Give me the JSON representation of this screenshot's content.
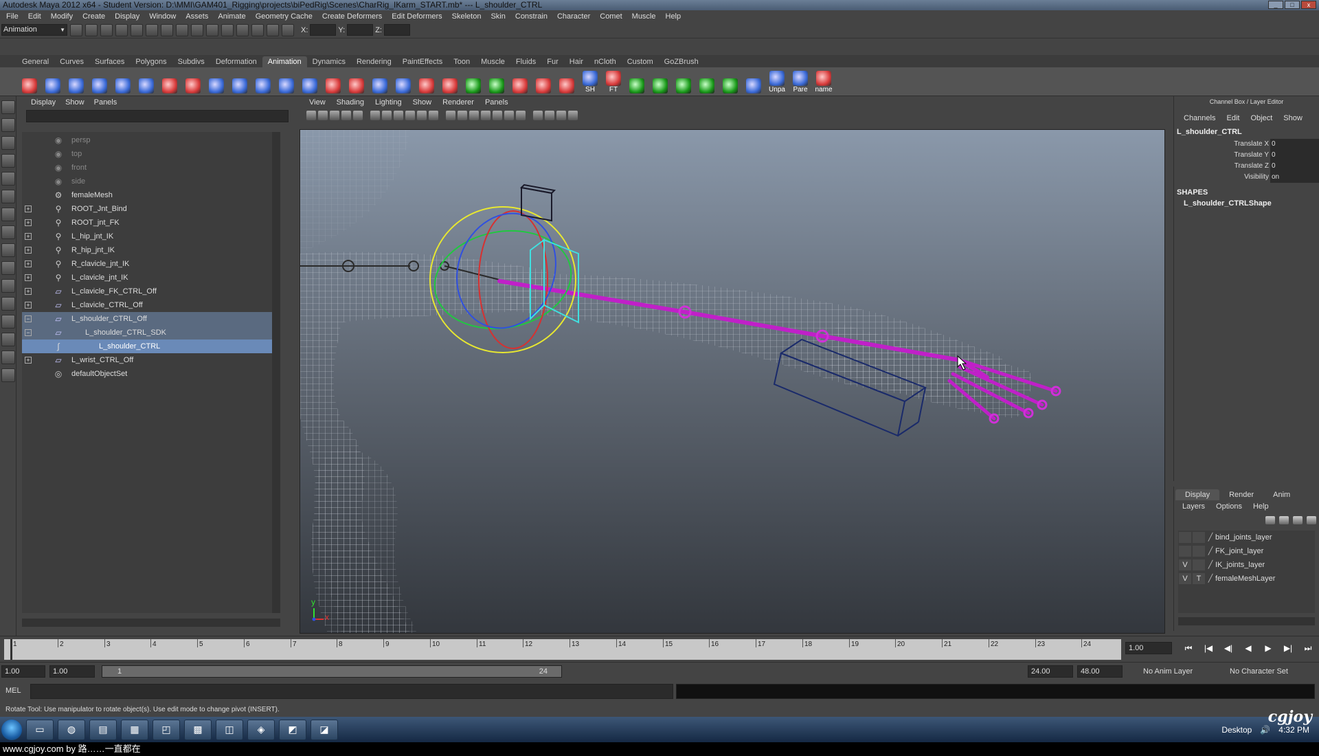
{
  "window": {
    "title": "Autodesk Maya 2012 x64 - Student Version: D:\\MMI\\GAM401_Rigging\\projects\\biPedRig\\Scenes\\CharRig_IKarm_START.mb*  ---  L_shoulder_CTRL"
  },
  "menubar": [
    "File",
    "Edit",
    "Modify",
    "Create",
    "Display",
    "Window",
    "Assets",
    "Animate",
    "Geometry Cache",
    "Create Deformers",
    "Edit Deformers",
    "Skeleton",
    "Skin",
    "Constrain",
    "Character",
    "Comet",
    "Muscle",
    "Help"
  ],
  "statusline": {
    "mode": "Animation",
    "x_label": "X:",
    "y_label": "Y:",
    "z_label": "Z:"
  },
  "shelf_tabs": [
    "General",
    "Curves",
    "Surfaces",
    "Polygons",
    "Subdivs",
    "Deformation",
    "Animation",
    "Dynamics",
    "Rendering",
    "PaintEffects",
    "Toon",
    "Muscle",
    "Fluids",
    "Fur",
    "Hair",
    "nCloth",
    "Custom",
    "GoZBrush"
  ],
  "shelf_active": "Animation",
  "shelf_labels": {
    "sh": "SH",
    "ft": "FT",
    "unpa": "Unpa",
    "pare": "Pare",
    "name": "name"
  },
  "outliner": {
    "menu": [
      "Display",
      "Show",
      "Panels"
    ],
    "rows": [
      {
        "label": "persp",
        "type": "camera"
      },
      {
        "label": "top",
        "type": "camera"
      },
      {
        "label": "front",
        "type": "camera"
      },
      {
        "label": "side",
        "type": "camera"
      },
      {
        "label": "femaleMesh",
        "type": "mesh"
      },
      {
        "label": "ROOT_Jnt_Bind",
        "type": "joint"
      },
      {
        "label": "ROOT_jnt_FK",
        "type": "joint"
      },
      {
        "label": "L_hip_jnt_IK",
        "type": "joint"
      },
      {
        "label": "R_hip_jnt_IK",
        "type": "joint"
      },
      {
        "label": "R_clavicle_jnt_IK",
        "type": "joint"
      },
      {
        "label": "L_clavicle_jnt_IK",
        "type": "joint"
      },
      {
        "label": "L_clavicle_FK_CTRL_Off",
        "type": "transform"
      },
      {
        "label": "L_clavicle_CTRL_Off",
        "type": "transform"
      },
      {
        "label": "L_shoulder_CTRL_Off",
        "type": "transform"
      },
      {
        "label": "L_shoulder_CTRL_SDK",
        "type": "transform"
      },
      {
        "label": "L_shoulder_CTRL",
        "type": "curve"
      },
      {
        "label": "L_wrist_CTRL_Off",
        "type": "transform"
      },
      {
        "label": "defaultObjectSet",
        "type": "set"
      }
    ]
  },
  "viewport": {
    "menu": [
      "View",
      "Shading",
      "Lighting",
      "Show",
      "Renderer",
      "Panels"
    ],
    "axis": {
      "y": "y",
      "x": "x"
    }
  },
  "channel_box": {
    "title": "Channel Box / Layer Editor",
    "menu": [
      "Channels",
      "Edit",
      "Object",
      "Show"
    ],
    "object": "L_shoulder_CTRL",
    "attrs": [
      {
        "name": "Translate X",
        "value": "0"
      },
      {
        "name": "Translate Y",
        "value": "0"
      },
      {
        "name": "Translate Z",
        "value": "0"
      },
      {
        "name": "Visibility",
        "value": "on"
      }
    ],
    "shapes_label": "SHAPES",
    "shape": "L_shoulder_CTRLShape"
  },
  "layer_editor": {
    "tabs": [
      "Display",
      "Render",
      "Anim"
    ],
    "active_tab": "Display",
    "menu": [
      "Layers",
      "Options",
      "Help"
    ],
    "layers": [
      {
        "v": "",
        "t": "",
        "name": "bind_joints_layer"
      },
      {
        "v": "",
        "t": "",
        "name": "FK_joint_layer"
      },
      {
        "v": "V",
        "t": "",
        "name": "IK_joints_layer"
      },
      {
        "v": "V",
        "t": "T",
        "name": "femaleMeshLayer"
      }
    ]
  },
  "timeline": {
    "ticks": [
      "1",
      "2",
      "3",
      "4",
      "5",
      "6",
      "7",
      "8",
      "9",
      "10",
      "11",
      "12",
      "13",
      "14",
      "15",
      "16",
      "17",
      "18",
      "19",
      "20",
      "21",
      "22",
      "23",
      "24"
    ],
    "current": "1.00",
    "playback": [
      "⏮",
      "|◀",
      "◀|",
      "◀",
      "▶",
      "▶|",
      "⏭"
    ]
  },
  "range": {
    "start": "1.00",
    "playback_start": "1.00",
    "slider_start": "1",
    "slider_end": "24",
    "playback_end": "24.00",
    "end": "48.00",
    "anim_layer": "No Anim Layer",
    "character_set": "No Character Set"
  },
  "mel": {
    "label": "MEL"
  },
  "help_line": "Rotate Tool: Use manipulator to rotate object(s). Use edit mode to change pivot (INSERT).",
  "taskbar": {
    "desktop": "Desktop",
    "clock": "4:32 PM"
  },
  "watermark": "www.cgjoy.com by 路……一直都在",
  "logo": "cgjoy"
}
